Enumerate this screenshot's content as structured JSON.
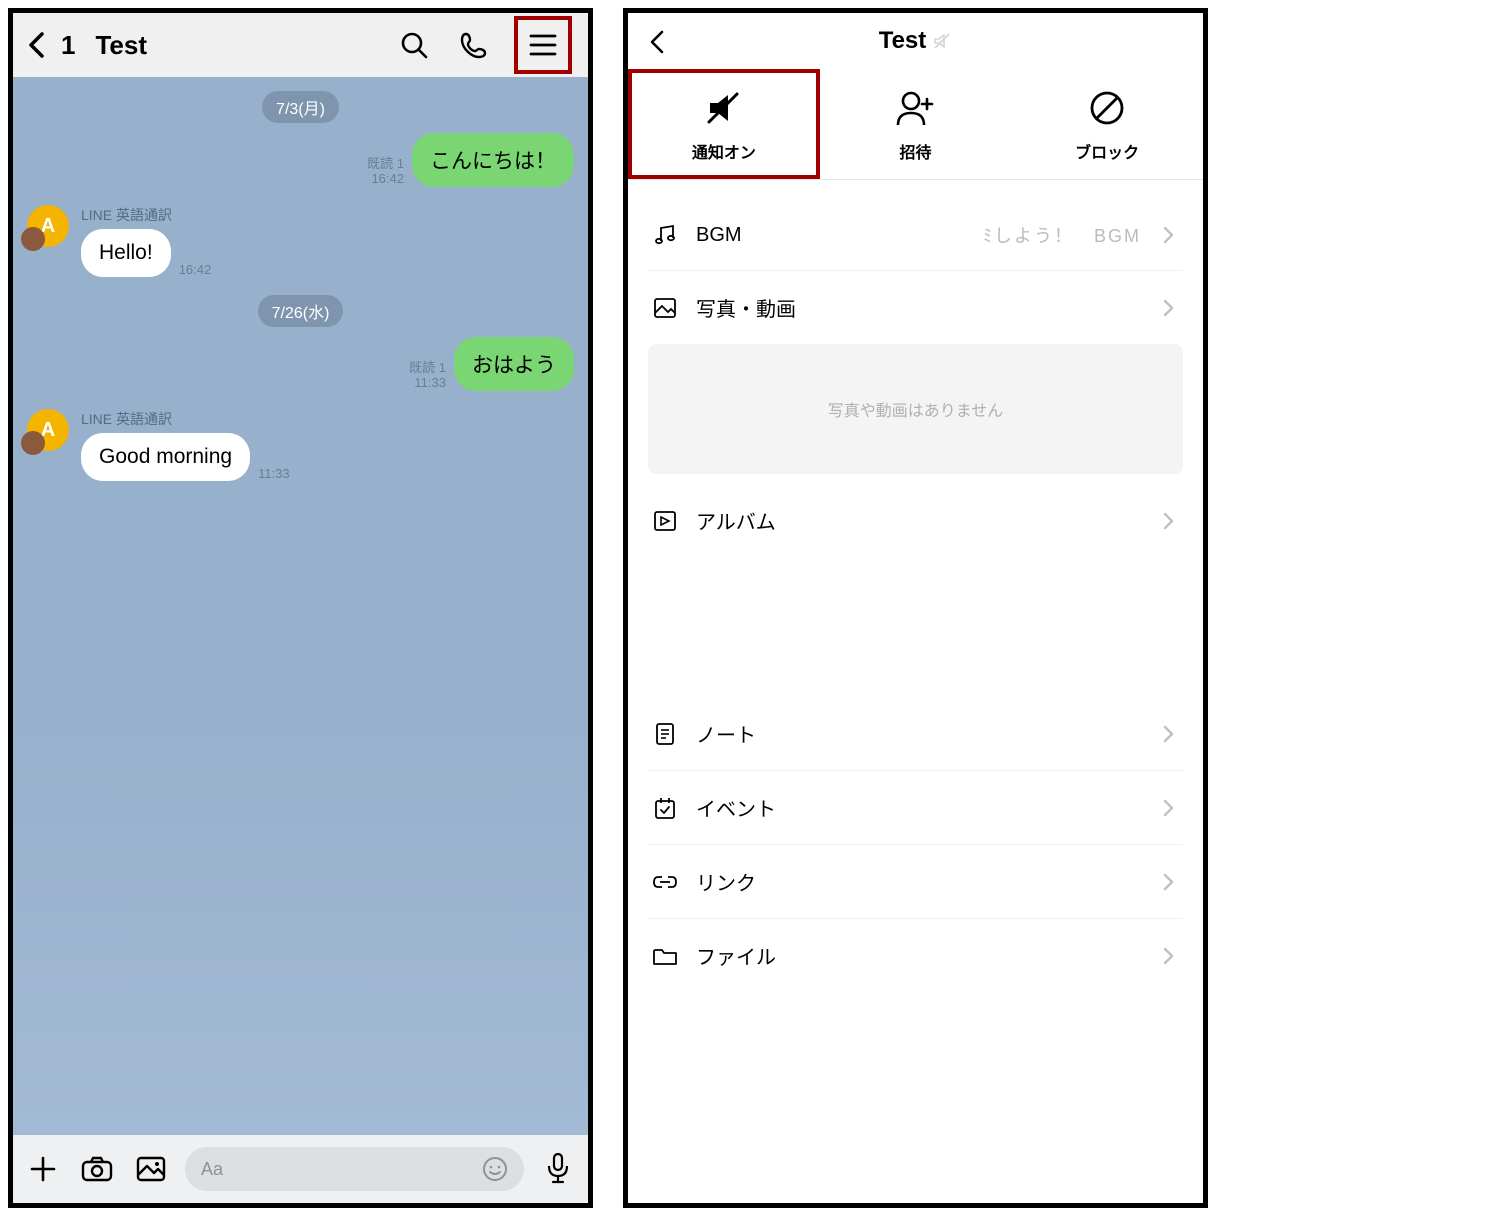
{
  "left": {
    "back_count": "1",
    "title": "Test",
    "dates": {
      "d1": "7/3(月)",
      "d2": "7/26(水)"
    },
    "msg1": {
      "read": "既読 1",
      "time": "16:42",
      "text": "こんにちは！"
    },
    "msg2": {
      "bot": "LINE 英語通訳",
      "text": "Hello!",
      "time": "16:42"
    },
    "msg3": {
      "read": "既読 1",
      "time": "11:33",
      "text": "おはよう"
    },
    "msg4": {
      "bot": "LINE 英語通訳",
      "text": "Good morning",
      "time": "11:33"
    },
    "input_placeholder": "Aa"
  },
  "right": {
    "title": "Test",
    "actions": {
      "notify": "通知オン",
      "invite": "招待",
      "block": "ブロック"
    },
    "menu": {
      "bgm": "BGM",
      "bgm_extra": "ﾐしよう！　BGM",
      "photos": "写真・動画",
      "photos_empty": "写真や動画はありません",
      "album": "アルバム",
      "note": "ノート",
      "event": "イベント",
      "link": "リンク",
      "file": "ファイル"
    }
  }
}
